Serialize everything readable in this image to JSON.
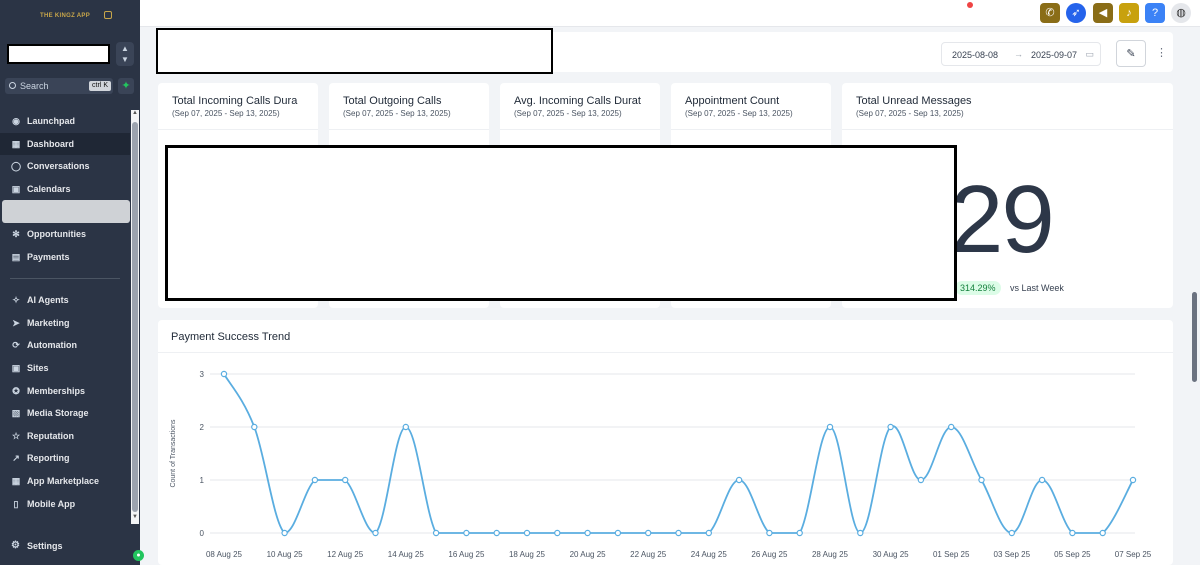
{
  "app": {
    "logo_text": "THE KINGZ APP"
  },
  "sidebar": {
    "location_switch_icon": "updown-chevron-icon",
    "search": {
      "placeholder": "Search",
      "shortcut": "ctrl K"
    },
    "items": [
      {
        "label": "Launchpad",
        "icon": "launchpad-icon",
        "glyph": "◉"
      },
      {
        "label": "Dashboard",
        "icon": "dashboard-icon",
        "glyph": "▦",
        "active": true
      },
      {
        "label": "Conversations",
        "icon": "chat-icon",
        "glyph": "◯"
      },
      {
        "label": "Calendars",
        "icon": "calendar-icon",
        "glyph": "▣"
      },
      {
        "label": "",
        "icon": "",
        "glyph": "",
        "hidden": true
      },
      {
        "label": "Opportunities",
        "icon": "opportunities-icon",
        "glyph": "✻"
      },
      {
        "label": "Payments",
        "icon": "payments-icon",
        "glyph": "▤"
      }
    ],
    "items2": [
      {
        "label": "AI Agents",
        "icon": "ai-agents-icon",
        "glyph": "✧"
      },
      {
        "label": "Marketing",
        "icon": "marketing-icon",
        "glyph": "➤"
      },
      {
        "label": "Automation",
        "icon": "automation-icon",
        "glyph": "⟳"
      },
      {
        "label": "Sites",
        "icon": "sites-icon",
        "glyph": "▣"
      },
      {
        "label": "Memberships",
        "icon": "memberships-icon",
        "glyph": "✪"
      },
      {
        "label": "Media Storage",
        "icon": "media-storage-icon",
        "glyph": "▧"
      },
      {
        "label": "Reputation",
        "icon": "reputation-icon",
        "glyph": "☆"
      },
      {
        "label": "Reporting",
        "icon": "reporting-icon",
        "glyph": "↗"
      },
      {
        "label": "App Marketplace",
        "icon": "app-marketplace-icon",
        "glyph": "▦"
      },
      {
        "label": "Mobile App",
        "icon": "mobile-app-icon",
        "glyph": "▯"
      }
    ],
    "settings_label": "Settings"
  },
  "header": {
    "date_start": "2025-08-08",
    "date_end": "2025-09-07"
  },
  "stats": [
    {
      "title": "Total Incoming Calls Dura",
      "range": "(Sep 07, 2025 - Sep 13, 2025)"
    },
    {
      "title": "Total Outgoing Calls",
      "range": "(Sep 07, 2025 - Sep 13, 2025)"
    },
    {
      "title": "Avg. Incoming Calls Durat",
      "range": "(Sep 07, 2025 - Sep 13, 2025)"
    },
    {
      "title": "Appointment Count",
      "range": "(Sep 07, 2025 - Sep 13, 2025)"
    },
    {
      "title": "Total Unread Messages",
      "range": "(Sep 07, 2025 - Sep 13, 2025)",
      "value": "29",
      "change": "314.29%",
      "change_label": "vs Last Week"
    }
  ],
  "chart_data": {
    "type": "line",
    "title": "Payment Success Trend",
    "ylabel": "Count of Transactions",
    "xlabel": "",
    "ylim": [
      0,
      3
    ],
    "yticks": [
      0,
      1,
      2,
      3
    ],
    "x": [
      "08 Aug 25",
      "09 Aug 25",
      "10 Aug 25",
      "11 Aug 25",
      "12 Aug 25",
      "13 Aug 25",
      "14 Aug 25",
      "15 Aug 25",
      "16 Aug 25",
      "17 Aug 25",
      "18 Aug 25",
      "19 Aug 25",
      "20 Aug 25",
      "21 Aug 25",
      "22 Aug 25",
      "23 Aug 25",
      "24 Aug 25",
      "25 Aug 25",
      "26 Aug 25",
      "27 Aug 25",
      "28 Aug 25",
      "29 Aug 25",
      "30 Aug 25",
      "31 Aug 25",
      "01 Sep 25",
      "02 Sep 25",
      "03 Sep 25",
      "04 Sep 25",
      "05 Sep 25",
      "06 Sep 25",
      "07 Sep 25"
    ],
    "xtick_labels": [
      "08 Aug 25",
      "10 Aug 25",
      "12 Aug 25",
      "14 Aug 25",
      "16 Aug 25",
      "18 Aug 25",
      "20 Aug 25",
      "22 Aug 25",
      "24 Aug 25",
      "26 Aug 25",
      "28 Aug 25",
      "30 Aug 25",
      "01 Sep 25",
      "03 Sep 25",
      "05 Sep 25",
      "07 Sep 25"
    ],
    "values": [
      3,
      2,
      0,
      1,
      1,
      0,
      2,
      0,
      0,
      0,
      0,
      0,
      0,
      0,
      0,
      0,
      0,
      1,
      0,
      0,
      2,
      0,
      2,
      1,
      2,
      1,
      0,
      1,
      0,
      0,
      1
    ],
    "color": "#5aade0",
    "grid": true
  }
}
